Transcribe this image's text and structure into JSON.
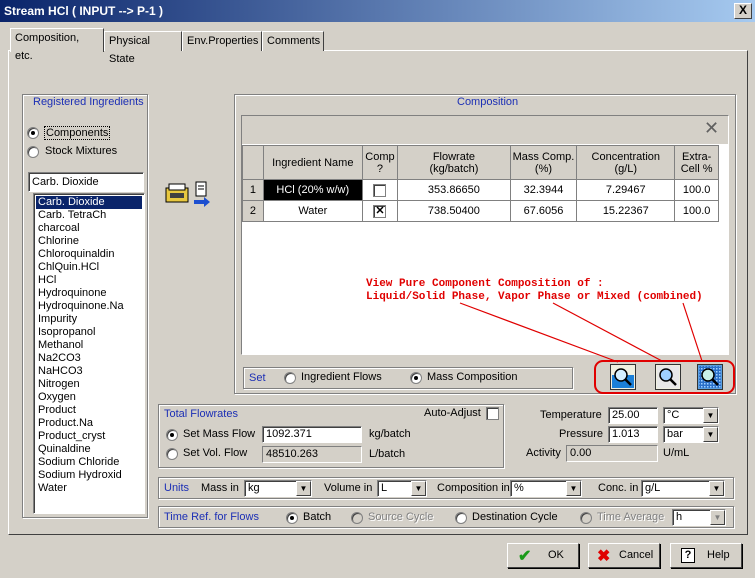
{
  "window": {
    "title": "Stream HCl ( INPUT --> P-1 )",
    "close_label": "X"
  },
  "tabs": [
    {
      "label": "Composition, etc."
    },
    {
      "label": "Physical State"
    },
    {
      "label": "Env.Properties"
    },
    {
      "label": "Comments"
    }
  ],
  "ingredients": {
    "title": "Registered Ingredients",
    "radio_components": "Components",
    "radio_stock": "Stock Mixtures",
    "search_value": "Carb. Dioxide",
    "items": [
      "Carb. Dioxide",
      "Carb. TetraCh",
      "charcoal",
      "Chlorine",
      "Chloroquinaldin",
      "ChlQuin.HCl",
      "HCl",
      "Hydroquinone",
      "Hydroquinone.Na",
      "Impurity",
      "Isopropanol",
      "Methanol",
      "Na2CO3",
      "NaHCO3",
      "Nitrogen",
      "Oxygen",
      "Product",
      "Product.Na",
      "Product_cryst",
      "Quinaldine",
      "Sodium Chloride",
      "Sodium Hydroxid",
      "Water"
    ]
  },
  "composition": {
    "title": "Composition",
    "clear_label": "✕",
    "headers": {
      "name": "Ingredient Name",
      "comp": "Comp\n?",
      "flow": "Flowrate\n(kg/batch)",
      "mass": "Mass Comp.\n(%)",
      "conc": "Concentration\n(g/L)",
      "extra": "Extra-\nCell %"
    },
    "rows": [
      {
        "num": "1",
        "name": "HCl (20% w/w)",
        "comp_checked": false,
        "flow": "353.86650",
        "mass": "32.3944",
        "conc": "7.29467",
        "extra": "100.0"
      },
      {
        "num": "2",
        "name": "Water",
        "comp_checked": true,
        "flow": "738.50400",
        "mass": "67.6056",
        "conc": "15.22367",
        "extra": "100.0"
      }
    ],
    "annotation_line1": "View Pure Component Composition of :",
    "annotation_line2": "Liquid/Solid Phase, Vapor Phase or Mixed (combined)",
    "set_label": "Set",
    "set_ingredient_flows": "Ingredient Flows",
    "set_mass_composition": "Mass Composition"
  },
  "totals": {
    "title": "Total Flowrates",
    "auto_adjust": "Auto-Adjust",
    "set_mass_flow": "Set Mass Flow",
    "mass_flow_value": "1092.371",
    "mass_flow_unit": "kg/batch",
    "set_vol_flow": "Set Vol. Flow",
    "vol_flow_value": "48510.263",
    "vol_flow_unit": "L/batch"
  },
  "conditions": {
    "temperature_label": "Temperature",
    "temperature_value": "25.00",
    "temperature_unit": "°C",
    "pressure_label": "Pressure",
    "pressure_value": "1.013",
    "pressure_unit": "bar",
    "activity_label": "Activity",
    "activity_value": "0.00",
    "activity_unit": "U/mL"
  },
  "units": {
    "title": "Units",
    "mass_label": "Mass in",
    "mass_value": "kg",
    "volume_label": "Volume in",
    "volume_value": "L",
    "comp_label": "Composition in",
    "comp_value": "%",
    "conc_label": "Conc. in",
    "conc_value": "g/L"
  },
  "timeref": {
    "title": "Time Ref. for Flows",
    "batch": "Batch",
    "source_cycle": "Source Cycle",
    "destination_cycle": "Destination Cycle",
    "time_average": "Time Average",
    "time_unit": "h"
  },
  "buttons": {
    "ok": "OK",
    "cancel": "Cancel",
    "help": "Help"
  }
}
